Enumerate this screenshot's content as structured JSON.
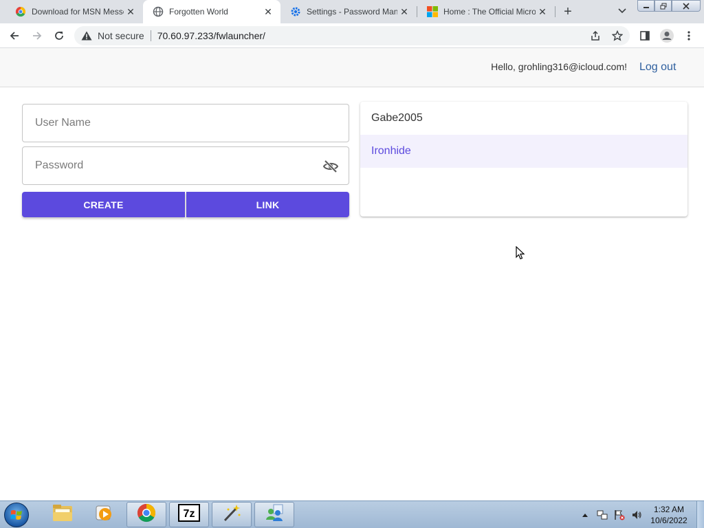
{
  "browser": {
    "tabs": [
      {
        "title": "Download for MSN Messe",
        "icon": "chrome-download-icon",
        "active": false
      },
      {
        "title": "Forgotten World",
        "icon": "globe-icon",
        "active": true
      },
      {
        "title": "Settings - Password Mana",
        "icon": "gear-icon",
        "active": false
      },
      {
        "title": "Home : The Official Micro",
        "icon": "microsoft-logo-icon",
        "active": false
      }
    ],
    "security_label": "Not secure",
    "url": "70.60.97.233/fwlauncher/"
  },
  "header": {
    "greeting": "Hello, grohling316@icloud.com!",
    "logout_label": "Log out"
  },
  "form": {
    "username_placeholder": "User Name",
    "password_placeholder": "Password",
    "create_label": "CREATE",
    "link_label": "LINK"
  },
  "accounts": {
    "items": [
      {
        "name": "Gabe2005",
        "selected": false
      },
      {
        "name": "Ironhide",
        "selected": true
      }
    ]
  },
  "taskbar": {
    "clock_time": "1:32 AM",
    "clock_date": "10/6/2022"
  },
  "colors": {
    "accent": "#5c4ade",
    "selected_row_bg": "#f3f1fd",
    "link": "#2e5f9e"
  }
}
